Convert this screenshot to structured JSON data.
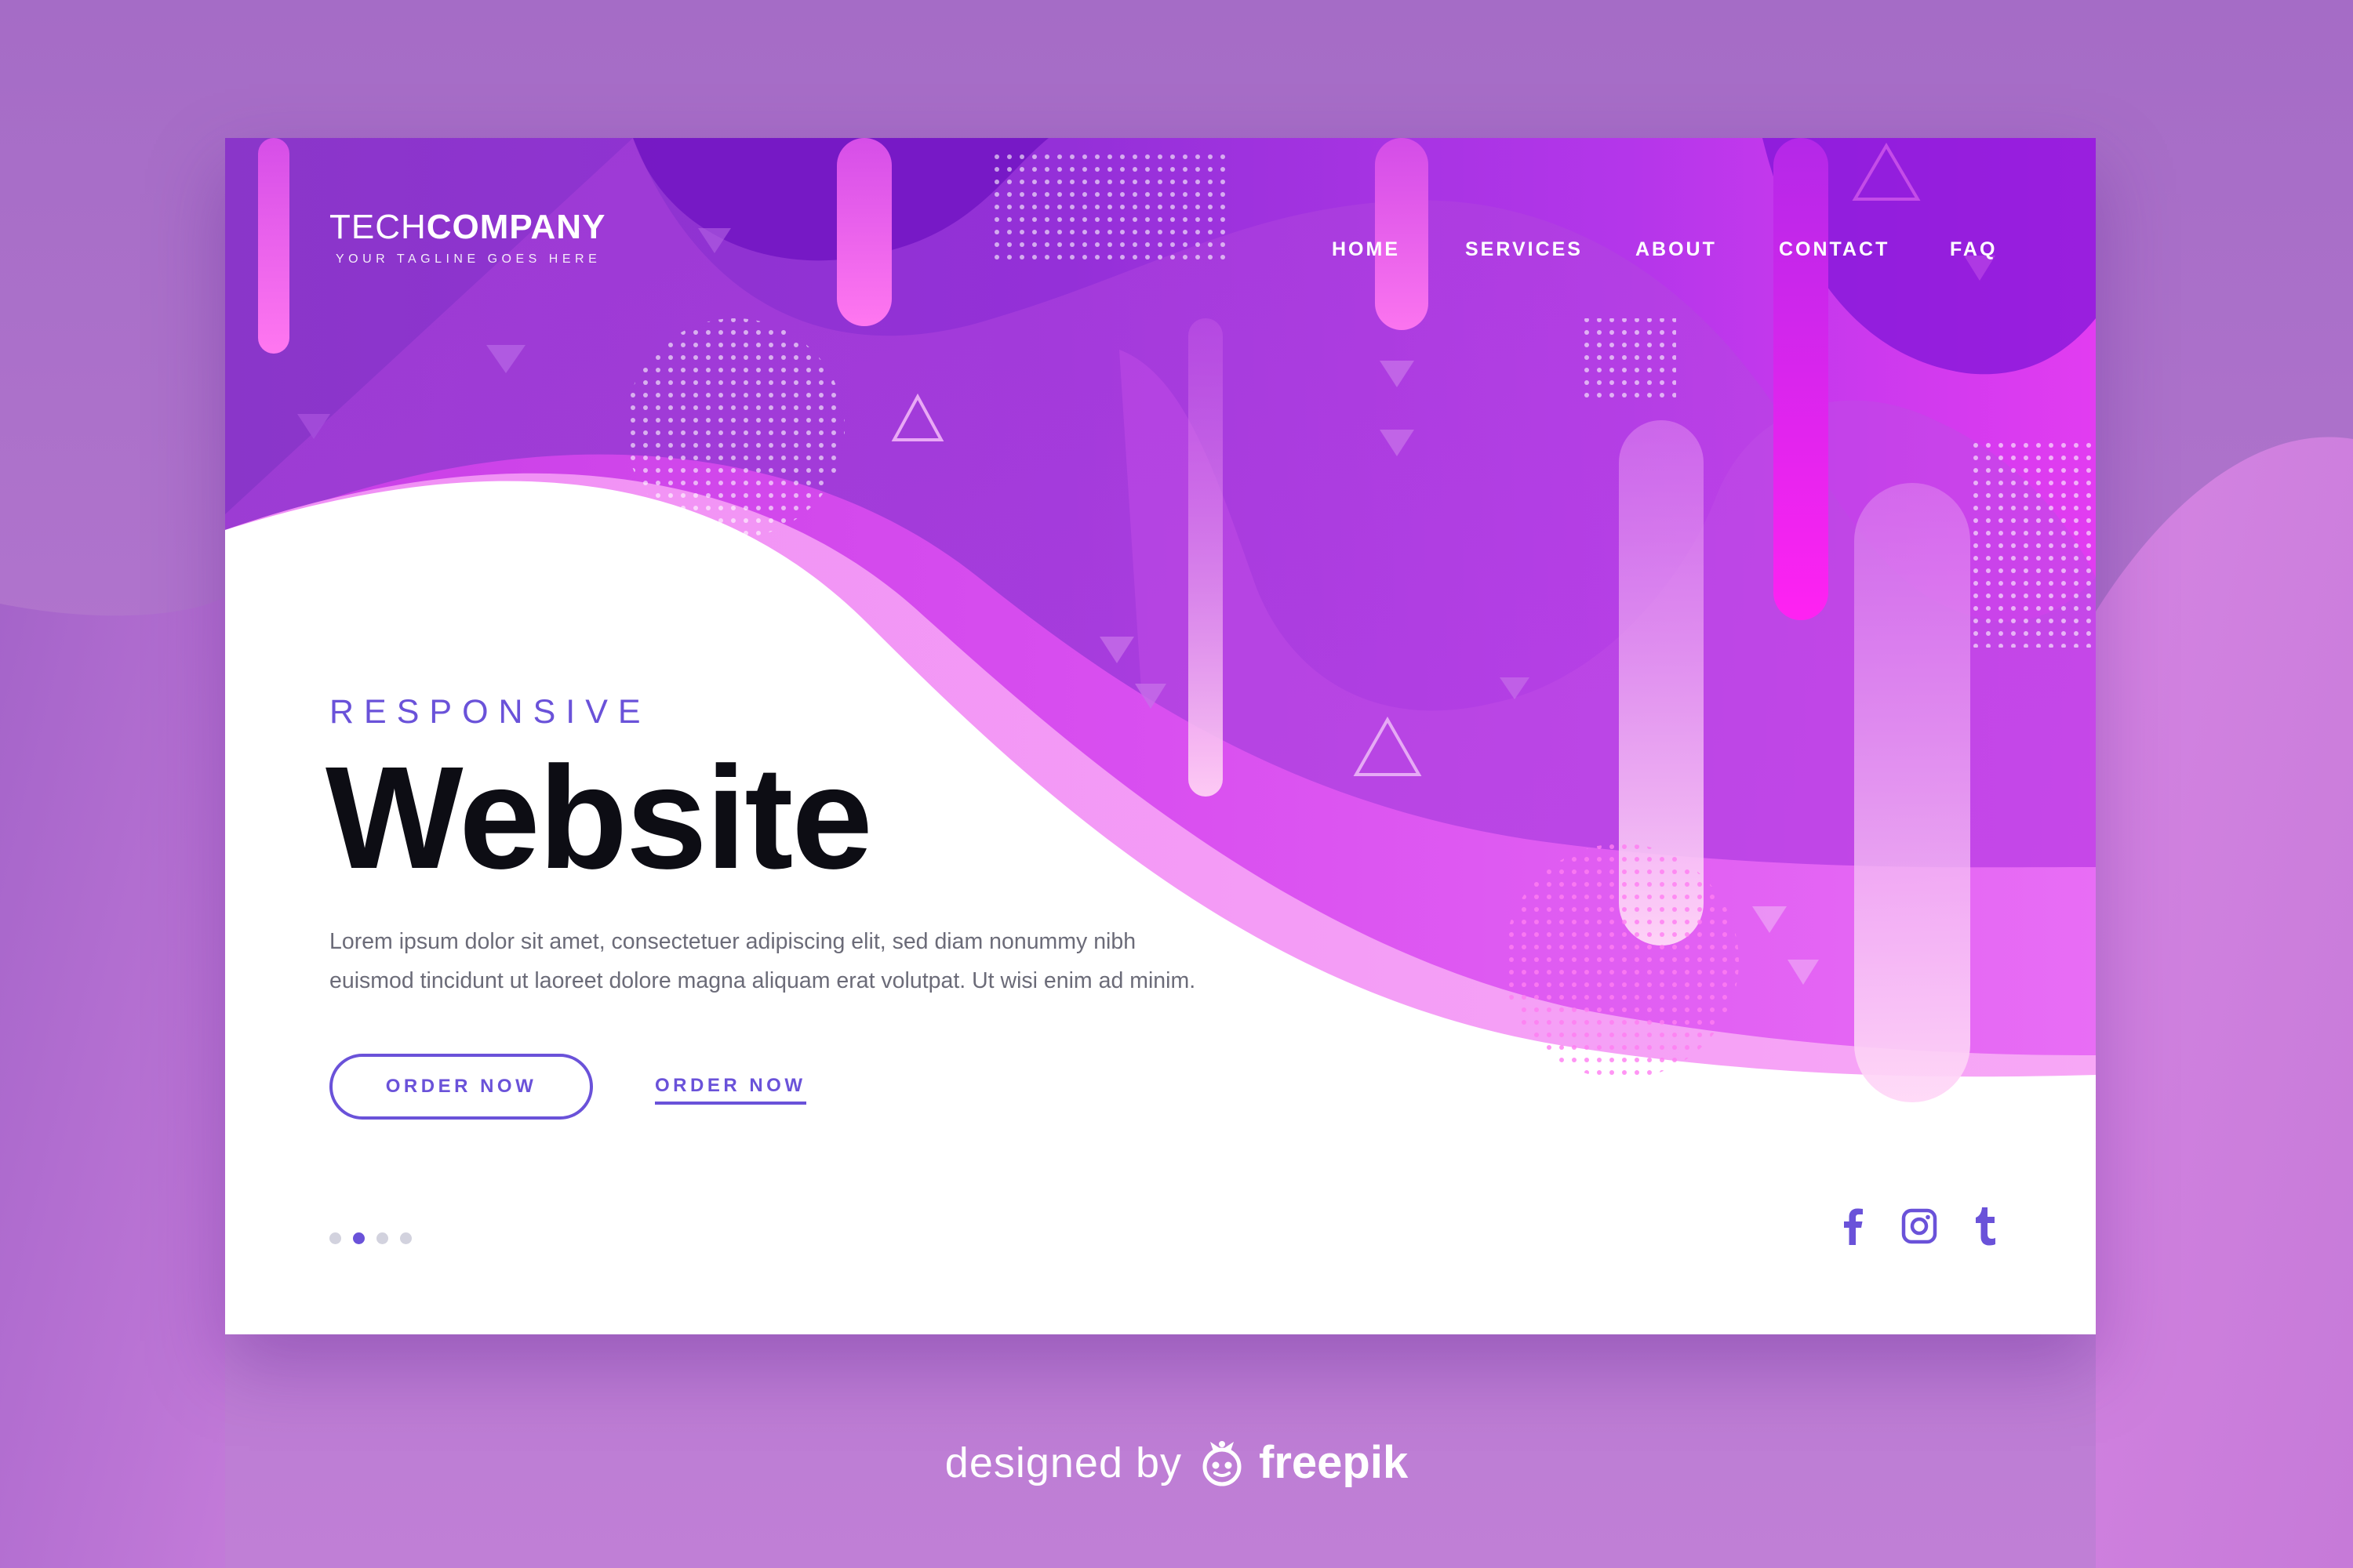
{
  "header": {
    "logo_light": "TECH",
    "logo_bold": "COMPANY",
    "tagline": "YOUR TAGLINE GOES HERE"
  },
  "nav": {
    "items": [
      "HOME",
      "SERVICES",
      "ABOUT",
      "CONTACT",
      "FAQ"
    ]
  },
  "hero": {
    "kicker": "RESPONSIVE",
    "title": "Website",
    "body_line1": "Lorem ipsum dolor sit amet, consectetuer adipiscing elit, sed diam nonummy nibh",
    "body_line2": "euismod tincidunt ut laoreet dolore magna aliquam erat volutpat. Ut wisi enim ad minim.",
    "primary_button": "ORDER NOW",
    "secondary_link": "ORDER NOW"
  },
  "pagination": {
    "count": 4,
    "active_index": 1
  },
  "social": {
    "icons": [
      "facebook-icon",
      "instagram-icon",
      "tumblr-icon"
    ]
  },
  "credit": {
    "prefix": "designed by",
    "brand": "freepik"
  },
  "colors": {
    "accent": "#6a52d9",
    "title": "#0d0d14",
    "body_text": "#6b6b78",
    "background": "#b977d2",
    "magenta": "#e33bf0",
    "purple": "#8a2fd6"
  }
}
